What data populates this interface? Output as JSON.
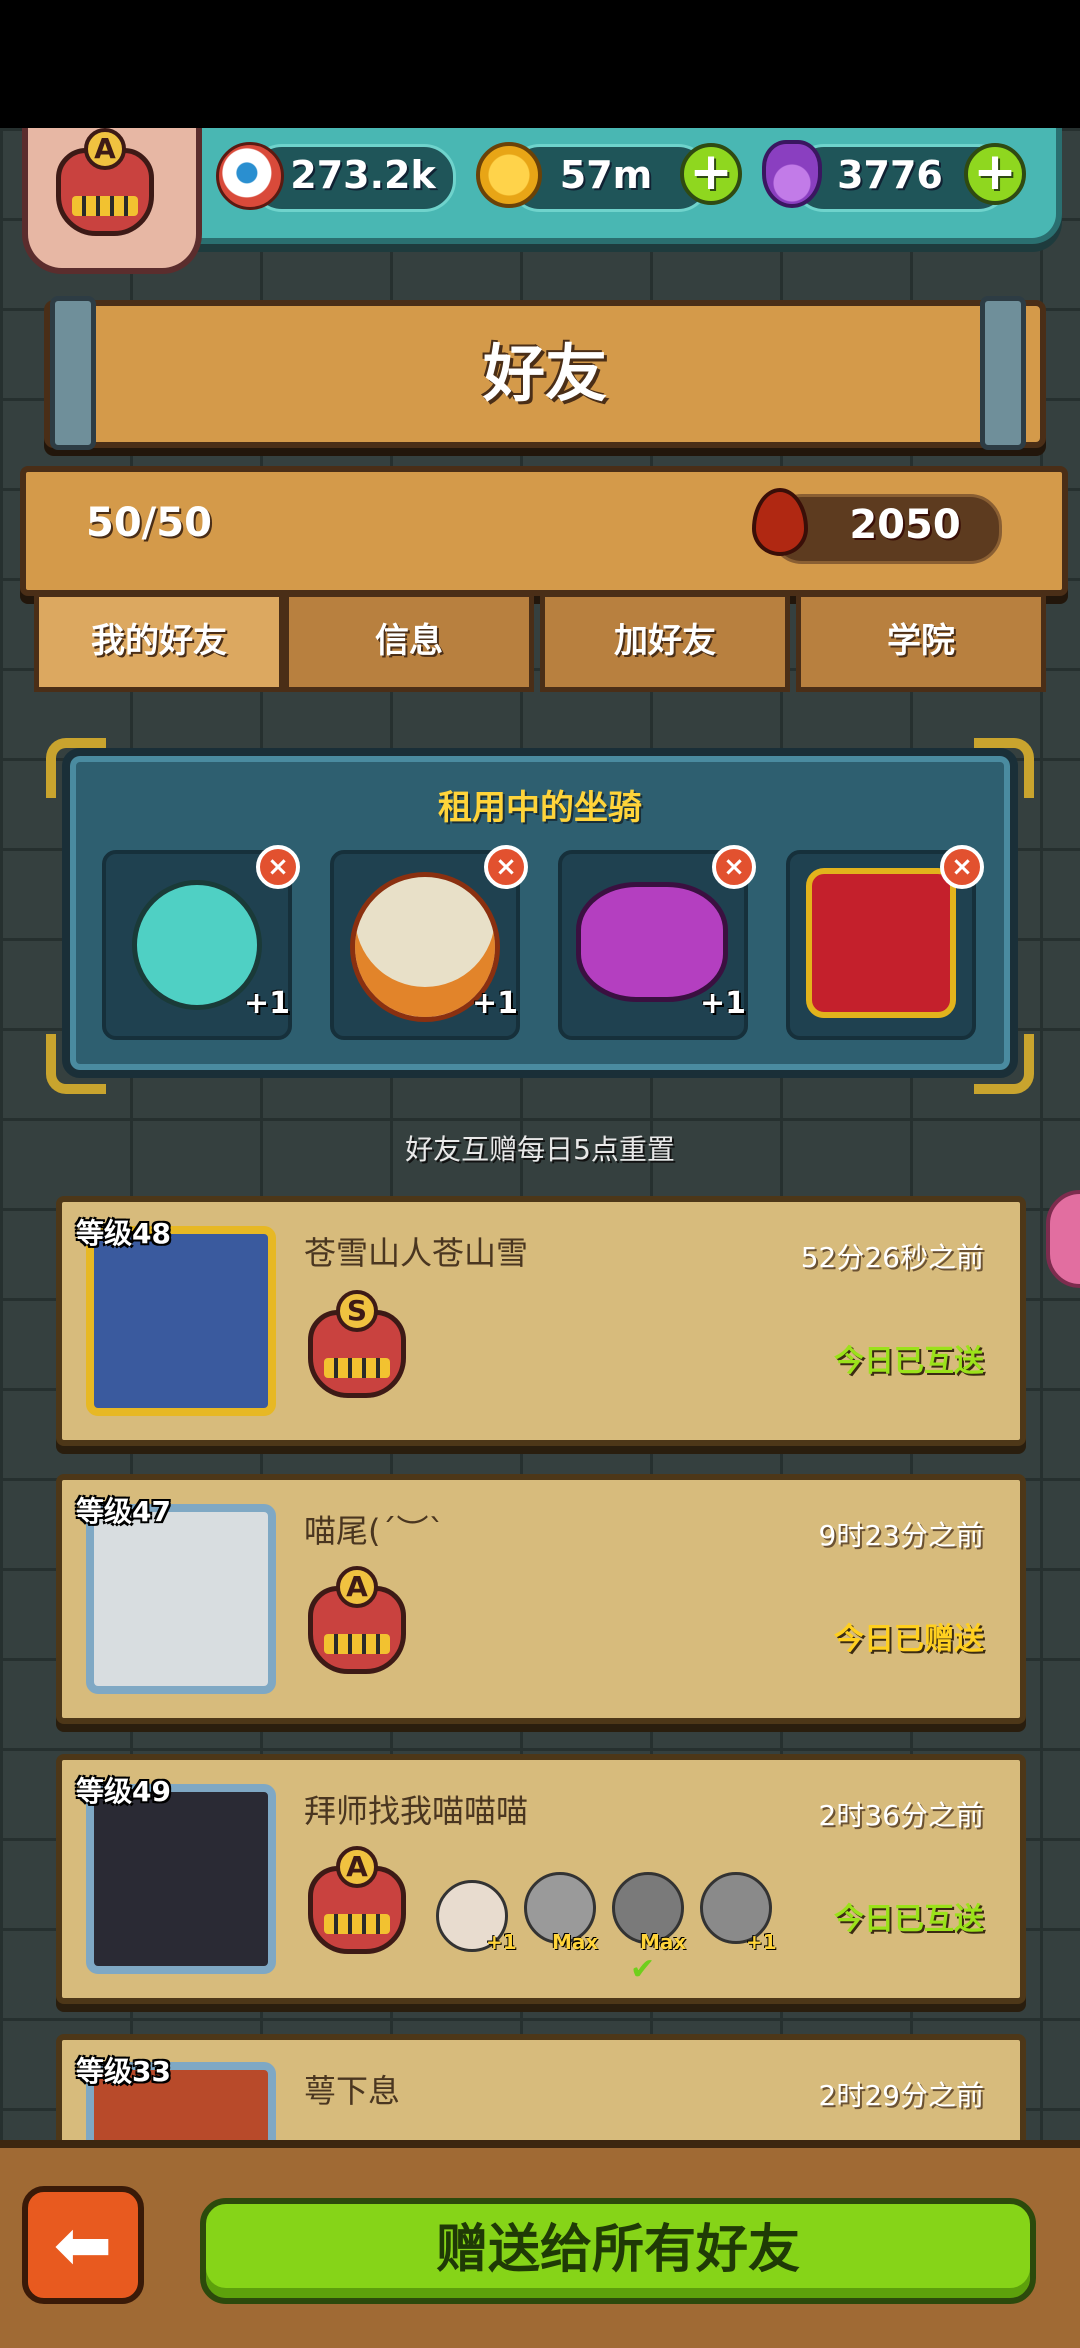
{
  "header": {
    "eye_value": "273.2k",
    "coin_value": "57m",
    "potion_value": "3776",
    "player_rank": "A",
    "plus_symbol": "+"
  },
  "title": "好友",
  "friend_count": "50/50",
  "blood_value": "2050",
  "tabs": [
    {
      "label": "我的好友",
      "active": true
    },
    {
      "label": "信息",
      "active": false
    },
    {
      "label": "加好友",
      "active": false
    },
    {
      "label": "学院",
      "active": false
    }
  ],
  "rented_mounts": {
    "title": "租用中的坐骑",
    "remove_symbol": "×",
    "slots": [
      {
        "icon": "teal-blob-mount-icon",
        "tag": "+1",
        "color": "#4fd0c4"
      },
      {
        "icon": "lion-dance-mount-icon",
        "tag": "+1",
        "color": "#e8e0c8"
      },
      {
        "icon": "purple-horned-mount-icon",
        "tag": "+1",
        "color": "#b43fc0"
      },
      {
        "icon": "red-throne-mount-icon",
        "tag": "",
        "color": "#c4202c"
      }
    ]
  },
  "reset_note": "好友互赠每日5点重置",
  "friends": [
    {
      "level": "等级48",
      "name": "苍雪山人苍山雪",
      "time": "52分26秒之前",
      "rank": "S",
      "status": "今日已互送",
      "status_color": "#9be21a",
      "frame": "#e7b824",
      "avatar_color": "#3a5a9e",
      "mounts": []
    },
    {
      "level": "等级47",
      "name": "喵尾(´︶`",
      "time": "9时23分之前",
      "rank": "A",
      "status": "今日已赠送",
      "status_color": "#ffd020",
      "frame": "#7fa8c4",
      "avatar_color": "#d8dde0",
      "mounts": []
    },
    {
      "level": "等级49",
      "name": "拜师找我喵喵喵",
      "time": "2时36分之前",
      "rank": "A",
      "status": "今日已互送",
      "status_color": "#9be21a",
      "frame": "#7fa8c4",
      "avatar_color": "#2a2a34",
      "mounts": [
        {
          "tag": "+1"
        },
        {
          "tag": "Max"
        },
        {
          "tag": "Max"
        },
        {
          "tag": "+1"
        }
      ]
    },
    {
      "level": "等级33",
      "name": "萼下息",
      "time": "2时29分之前",
      "rank": "A",
      "status": "",
      "status_color": "#9be21a",
      "frame": "#7fa8c4",
      "avatar_color": "#b84a2a",
      "mounts": []
    }
  ],
  "bottom": {
    "back_arrow": "⬅",
    "send_all_label": "赠送给所有好友"
  }
}
